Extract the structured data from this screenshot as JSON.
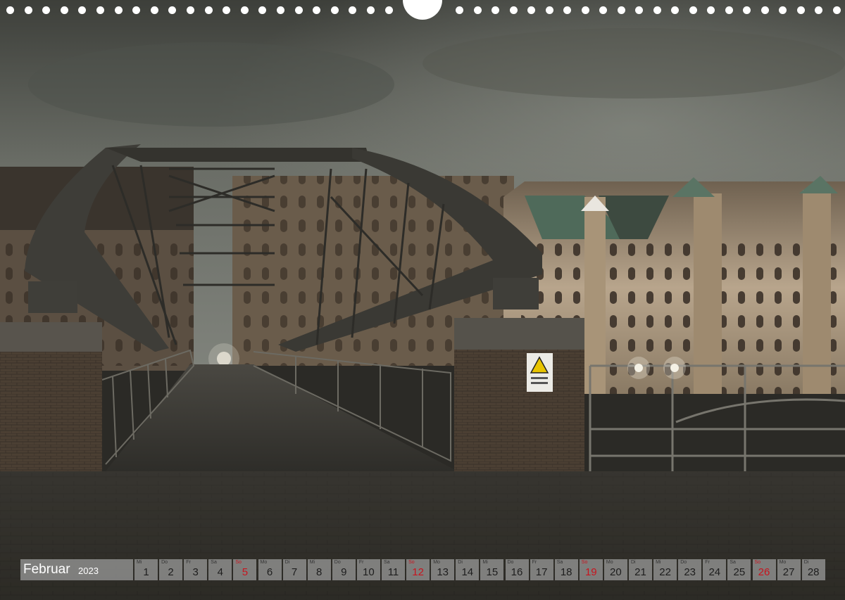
{
  "photo": {
    "description_icon": "bridge-photo",
    "sign_icon": "warning-sign-icon"
  },
  "calendar": {
    "month": "Februar",
    "year": "2023",
    "sunday_color": "#c8141e",
    "days": [
      {
        "wd": "Mi",
        "n": "1"
      },
      {
        "wd": "Do",
        "n": "2"
      },
      {
        "wd": "Fr",
        "n": "3"
      },
      {
        "wd": "Sa",
        "n": "4"
      },
      {
        "wd": "So",
        "n": "5",
        "sun": true
      },
      {
        "wd": "Mo",
        "n": "6"
      },
      {
        "wd": "Di",
        "n": "7"
      },
      {
        "wd": "Mi",
        "n": "8"
      },
      {
        "wd": "Do",
        "n": "9"
      },
      {
        "wd": "Fr",
        "n": "10"
      },
      {
        "wd": "Sa",
        "n": "11"
      },
      {
        "wd": "So",
        "n": "12",
        "sun": true
      },
      {
        "wd": "Mo",
        "n": "13"
      },
      {
        "wd": "Di",
        "n": "14"
      },
      {
        "wd": "Mi",
        "n": "15"
      },
      {
        "wd": "Do",
        "n": "16"
      },
      {
        "wd": "Fr",
        "n": "17"
      },
      {
        "wd": "Sa",
        "n": "18"
      },
      {
        "wd": "So",
        "n": "19",
        "sun": true
      },
      {
        "wd": "Mo",
        "n": "20"
      },
      {
        "wd": "Di",
        "n": "21"
      },
      {
        "wd": "Mi",
        "n": "22"
      },
      {
        "wd": "Do",
        "n": "23"
      },
      {
        "wd": "Fr",
        "n": "24"
      },
      {
        "wd": "Sa",
        "n": "25"
      },
      {
        "wd": "So",
        "n": "26",
        "sun": true
      },
      {
        "wd": "Mo",
        "n": "27"
      },
      {
        "wd": "Di",
        "n": "28"
      }
    ]
  }
}
